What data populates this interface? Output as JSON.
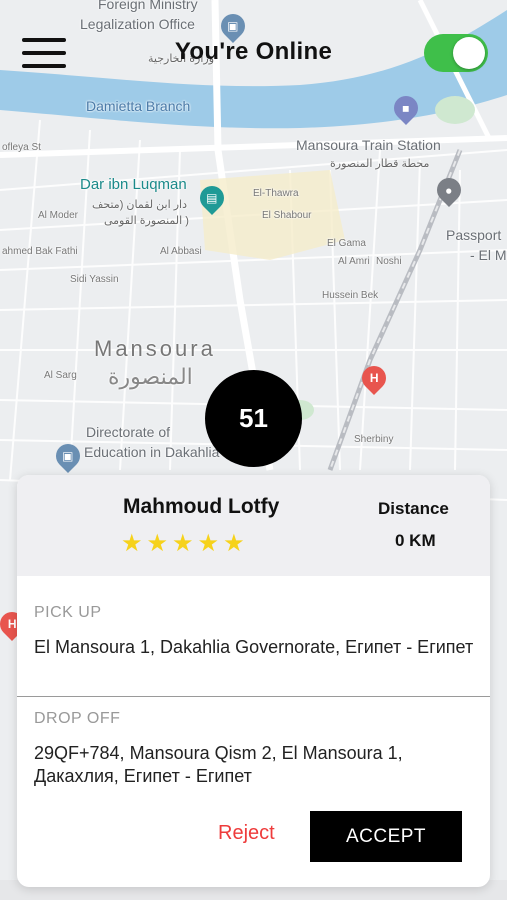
{
  "header": {
    "status_text": "You're Online",
    "online": true
  },
  "map": {
    "labels": {
      "foreign_ministry_1": "Foreign Ministry",
      "foreign_ministry_2": "Legalization Office",
      "foreign_ministry_ar": "وزارة الخارجية",
      "damietta_branch": "Damietta Branch",
      "train_station": "Mansoura Train Station",
      "train_station_ar": "محطة قطار المنصورة",
      "dar_ibn_luqman": "Dar ibn Luqman",
      "dar_ibn_luqman_ar1": "دار ابن لقمان (متحف",
      "dar_ibn_luqman_ar2": "المنصورة القومى )",
      "city_en": "Mansoura",
      "city_ar": "المنصورة",
      "directorate_1": "Directorate of",
      "directorate_2": "Education in Dakahlia",
      "passport_1": "Passport",
      "passport_2": "- El Ma",
      "el_thawra": "El-Thawra",
      "el_shabour": "El Shabour",
      "el_gama": "El Gama",
      "al_amri": "Al Amri",
      "noshi": "Noshi",
      "hussein_bek": "Hussein Bek",
      "sherbiny": "Sherbiny",
      "al_abbasi": "Al Abbasi",
      "al_moder": "Al Moder",
      "sidi_yassin": "Sidi Yassin",
      "al_sarg": "Al Sarg",
      "ahmed_bakfathi": "ahmed Bak Fathi",
      "ofleya": "ofleya St"
    }
  },
  "countdown": {
    "value": "51"
  },
  "request": {
    "rider_name": "Mahmoud Lotfy",
    "rating": 5,
    "distance_label": "Distance",
    "distance_value": "0 KM",
    "pickup_label": "PICK UP",
    "pickup_address": "El Mansoura 1, Dakahlia Governorate, Египет - Египет",
    "dropoff_label": "DROP OFF",
    "dropoff_address": "29QF+784, Mansoura Qism 2, El Mansoura 1, Дакахлия, Египет - Египет",
    "reject_label": "Reject",
    "accept_label": "ACCEPT"
  },
  "colors": {
    "online_toggle": "#3fbf4a",
    "star": "#f6d21b",
    "reject": "#ee3b3b",
    "accept_bg": "#000000",
    "water": "#9ecbe8"
  }
}
